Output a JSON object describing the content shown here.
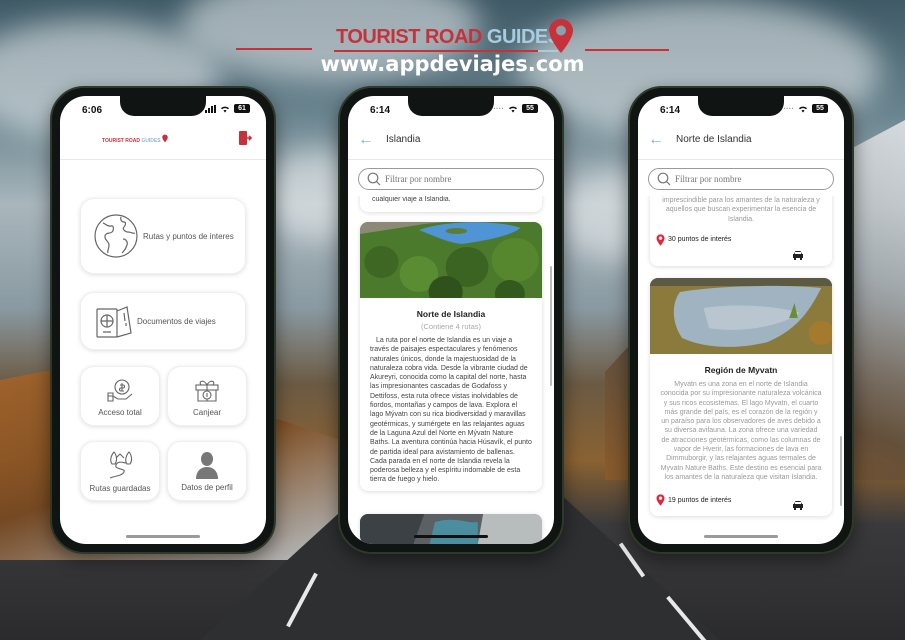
{
  "brand": {
    "name_red": "TOURIST ROAD",
    "name_blue": "GUIDES",
    "url": "www.appdeviajes.com",
    "colors": {
      "red": "#c7323a",
      "blue": "#a8cbe0"
    }
  },
  "phones": [
    {
      "status": {
        "time": "6:06",
        "battery": "61"
      },
      "header": {
        "logo_red": "TOURIST ROAD",
        "logo_blue": "GUIDES",
        "exit_icon": "exit-door-icon"
      },
      "menu": [
        {
          "label": "Rutas y puntos de interes",
          "icon": "globe-icon"
        },
        {
          "label": "Documentos de viajes",
          "icon": "passport-ticket-icon"
        },
        {
          "label": "Acceso total",
          "icon": "hand-money-icon"
        },
        {
          "label": "Canjear",
          "icon": "gift-coin-icon"
        },
        {
          "label": "Rutas guardadas",
          "icon": "mountain-route-icon"
        },
        {
          "label": "Datos de perfil",
          "icon": "user-icon"
        }
      ]
    },
    {
      "status": {
        "time": "6:14",
        "battery": "55"
      },
      "header": {
        "title": "Islandia"
      },
      "search": {
        "placeholder": "Filtrar por nombre",
        "value": ""
      },
      "prev_card_fragment": "cualquier viaje a Islandia.",
      "card": {
        "title": "Norte de Islandia",
        "subtitle": "(Contiene 4 rutas)",
        "body": "La ruta por el norte de Islandia es un viaje a través de paisajes espectaculares y fenómenos naturales únicos, donde la majestuosidad de la naturaleza cobra vida. Desde la vibrante ciudad de Akureyri, conocida como la capital del norte, hasta las impresionantes cascadas de Godafoss y Dettifoss, esta ruta ofrece vistas inolvidables de fiordos, montañas y campos de lava. Explora el lago Mývatn con su rica biodiversidad y maravillas geotérmicas, y sumérgete en las relajantes aguas de la Laguna Azul del Norte en Mývatn Nature Baths. La aventura continúa hacia Húsavík, el punto de partida ideal para avistamiento de ballenas. Cada parada en el norte de Islandia revela la poderosa belleza y el espíritu indomable de esta tierra de fuego y hielo."
      }
    },
    {
      "status": {
        "time": "6:14",
        "battery": "55"
      },
      "header": {
        "title": "Norte de Islandia"
      },
      "search": {
        "placeholder": "Filtrar por nombre",
        "value": ""
      },
      "prev_card": {
        "fragment": "imprescindible para los amantes de la naturaleza y aquellos que buscan experimentar la esencia de Islandia.",
        "points": "30 puntos de interés"
      },
      "card": {
        "title": "Región de Myvatn",
        "body": "Myvatn es una zona en el norte de Islandia conocida por su impresionante naturaleza volcánica y sus ricos ecosistemas. El lago Myvatn, el cuarto más grande del país, es el corazón de la región y un paraíso para los observadores de aves debido a su diversa avifauna. La zona ofrece una variedad de atracciones geotérmicas, como las columnas de vapor de Hverir, las formaciones de lava en Dimmuborgir, y las relajantes aguas termales de Myvatn Nature Baths. Este destino es esencial para los amantes de la naturaleza que visitan Islandia.",
        "points": "19 puntos de interés"
      }
    }
  ]
}
